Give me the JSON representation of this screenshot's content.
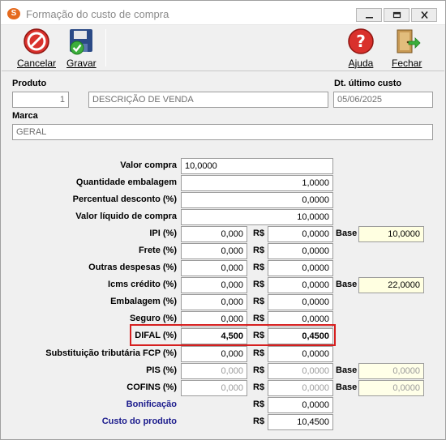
{
  "window": {
    "title": "Formação do custo de compra",
    "app_icon_letter": "S"
  },
  "toolbar": {
    "cancel_label": "Cancelar",
    "save_label": "Gravar",
    "help_label": "Ajuda",
    "close_label": "Fechar"
  },
  "header": {
    "produto_label": "Produto",
    "produto_code": "1",
    "produto_desc": "DESCRIÇÃO DE VENDA",
    "dt_label": "Dt. último custo",
    "dt_value": "05/06/2025",
    "marca_label": "Marca",
    "marca_value": "GERAL"
  },
  "summary": [
    {
      "label": "Valor compra",
      "value": "10,0000"
    },
    {
      "label": "Quantidade embalagem",
      "value": "1,0000"
    },
    {
      "label": "Percentual desconto (%)",
      "value": "0,0000"
    },
    {
      "label": "Valor líquido de compra",
      "value": "10,0000"
    }
  ],
  "currency_label": "R$",
  "rows": [
    {
      "label": "IPI (%)",
      "pct": "0,000",
      "value": "0,0000",
      "base_label": "Base",
      "base": "10,0000"
    },
    {
      "label": "Frete (%)",
      "pct": "0,000",
      "value": "0,0000"
    },
    {
      "label": "Outras despesas (%)",
      "pct": "0,000",
      "value": "0,0000"
    },
    {
      "label": "Icms crédito (%)",
      "pct": "0,000",
      "value": "0,0000",
      "base_label": "Base",
      "base": "22,0000"
    },
    {
      "label": "Embalagem (%)",
      "pct": "0,000",
      "value": "0,0000"
    },
    {
      "label": "Seguro (%)",
      "pct": "0,000",
      "value": "0,0000"
    },
    {
      "label": "DIFAL (%)",
      "pct": "4,500",
      "value": "0,4500"
    },
    {
      "label": "Substituição tributária FCP (%)",
      "pct": "0,000",
      "value": "0,0000"
    },
    {
      "label": "PIS (%)",
      "pct": "0,000",
      "value": "0,0000",
      "base_label": "Base",
      "base": "0,0000"
    },
    {
      "label": "COFINS (%)",
      "pct": "0,000",
      "value": "0,0000",
      "base_label": "Base",
      "base": "0,0000"
    }
  ],
  "totals": [
    {
      "label": "Bonificação",
      "value": "0,0000"
    },
    {
      "label": "Custo do produto",
      "value": "10,4500"
    }
  ],
  "colors": {
    "highlight": "#d61f1f",
    "label_blue": "#1a1a8c",
    "base_bg": "#ffffe1"
  }
}
